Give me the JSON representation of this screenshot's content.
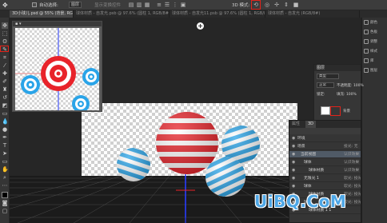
{
  "options_bar": {
    "auto_select_label": "自动选择:",
    "auto_select_value": "图层",
    "transform_label": "显示变换控件",
    "mode_label": "3D 模式:"
  },
  "tabs": [
    "3D小球儿.psd @ 55% (背景, RGB/8#) *",
    "球体材质 - 自发光.psb @ 97.6% (圆柱 1, RGB/8#)",
    "球体材质 - 自发光11.psb @ 97.6% (圆柱 1, RGB/8#)",
    "球体材质 - 自发光 (RGB/8#)"
  ],
  "right_strip": [
    "颜色",
    "色板",
    "调整",
    "样式",
    "库",
    "图层"
  ],
  "adjust_panel": {
    "title": "图层",
    "kind_label": "类型",
    "blend_mode": "正常",
    "opacity_label": "不透明度: 100%",
    "lock_label": "锁定:",
    "fill_label": "填充: 100%",
    "layer_name": "背景"
  },
  "panel3d": {
    "tabs": [
      "属性",
      "3D"
    ],
    "rows": [
      {
        "label": "环境",
        "side": ""
      },
      {
        "label": "场景",
        "side": "投光: 无"
      },
      {
        "label": "当前视图",
        "side": "认识效果",
        "selected": true
      },
      {
        "label": "球体",
        "side": "认识效果"
      },
      {
        "label": "球体材质",
        "side": "认识效果"
      },
      {
        "label": "无限光 1",
        "side": "软光: 投光"
      },
      {
        "label": "球体",
        "side": "软光: 投光"
      },
      {
        "label": "球体材质",
        "side": "软光: 投光"
      },
      {
        "label": "球体",
        "side": "软光: 投光"
      },
      {
        "label": "球体材质 1 1",
        "side": ""
      }
    ]
  },
  "watermark": "UiBQ.CoM",
  "colors": {
    "accent_red": "#e2231a",
    "ball_red": "#e8232a",
    "ball_blue": "#2aa4e8",
    "axis_blue": "#2a3cff"
  }
}
